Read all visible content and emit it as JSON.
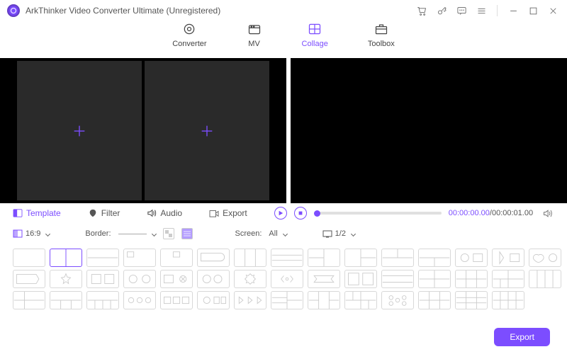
{
  "app": {
    "title": "ArkThinker Video Converter Ultimate (Unregistered)"
  },
  "toolbar": {
    "tabs": [
      "Converter",
      "MV",
      "Collage",
      "Toolbox"
    ],
    "active_index": 2
  },
  "subtabs": {
    "items": [
      "Template",
      "Filter",
      "Audio",
      "Export"
    ],
    "active_index": 0
  },
  "playback": {
    "current_time": "00:00:00.00",
    "total_time": "00:00:01.00"
  },
  "controls": {
    "ratio_label": "16:9",
    "border_label": "Border:",
    "screen_label": "Screen:",
    "screen_value": "All",
    "page_value": "1/2"
  },
  "footer": {
    "export_label": "Export"
  }
}
